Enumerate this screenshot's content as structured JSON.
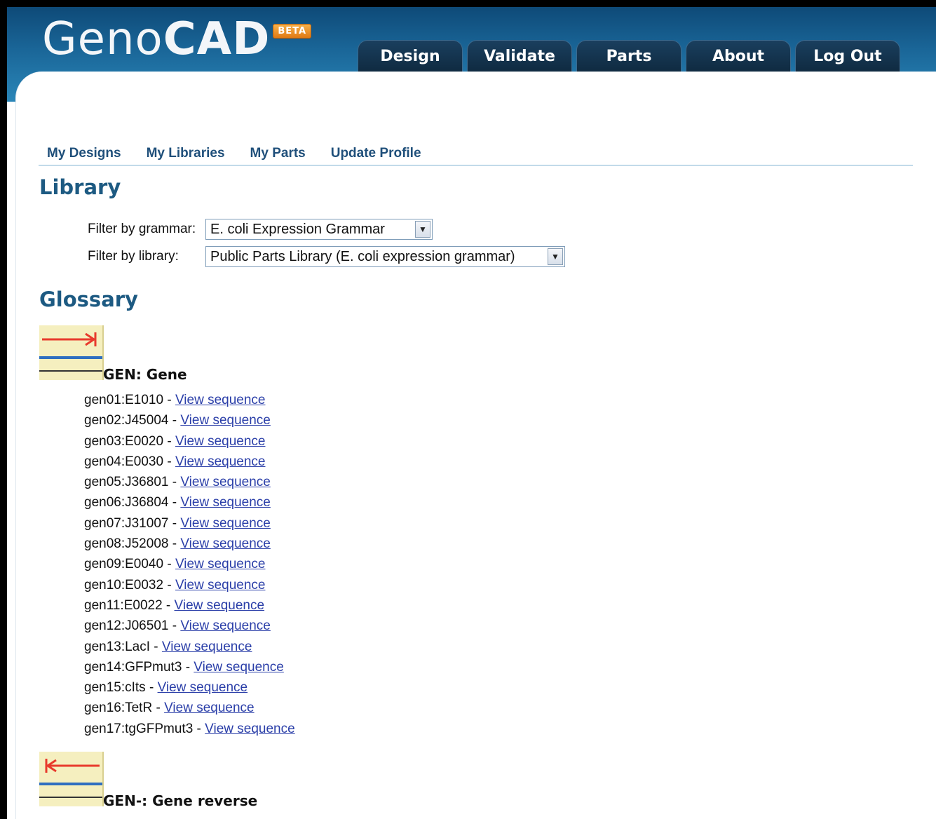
{
  "header": {
    "logo_text_light": "Geno",
    "logo_text_bold": "CAD",
    "logo_badge": "BETA",
    "tabs": [
      "Design",
      "Validate",
      "Parts",
      "About",
      "Log Out"
    ]
  },
  "subnav": {
    "links": [
      "My Designs",
      "My Libraries",
      "My Parts",
      "Update Profile"
    ]
  },
  "library": {
    "title": "Library",
    "grammar_label": "Filter by grammar:",
    "grammar_value": "E. coli Expression Grammar",
    "library_label": "Filter by library:",
    "library_value": "Public Parts Library (E. coli expression grammar)"
  },
  "glossary": {
    "title": "Glossary",
    "categories": [
      {
        "code_title": "GEN: Gene",
        "icon": "gene-forward-icon",
        "parts": [
          {
            "id": "gen01:E1010 - ",
            "link": "View sequence"
          },
          {
            "id": "gen02:J45004 - ",
            "link": "View sequence"
          },
          {
            "id": "gen03:E0020 - ",
            "link": "View sequence"
          },
          {
            "id": "gen04:E0030 - ",
            "link": "View sequence"
          },
          {
            "id": "gen05:J36801 - ",
            "link": "View sequence"
          },
          {
            "id": "gen06:J36804 - ",
            "link": "View sequence"
          },
          {
            "id": "gen07:J31007 - ",
            "link": "View sequence"
          },
          {
            "id": "gen08:J52008 - ",
            "link": "View sequence"
          },
          {
            "id": "gen09:E0040 - ",
            "link": "View sequence"
          },
          {
            "id": "gen10:E0032 - ",
            "link": "View sequence"
          },
          {
            "id": "gen11:E0022 - ",
            "link": "View sequence"
          },
          {
            "id": "gen12:J06501 - ",
            "link": "View sequence"
          },
          {
            "id": "gen13:LacI - ",
            "link": "View sequence"
          },
          {
            "id": "gen14:GFPmut3 - ",
            "link": "View sequence"
          },
          {
            "id": "gen15:cIts - ",
            "link": "View sequence"
          },
          {
            "id": "gen16:TetR - ",
            "link": "View sequence"
          },
          {
            "id": "gen17:tgGFPmut3 - ",
            "link": "View sequence"
          }
        ]
      },
      {
        "code_title": "GEN-: Gene reverse",
        "icon": "gene-reverse-icon"
      }
    ]
  },
  "colors": {
    "header_blue": "#1a6698",
    "tab_dark": "#0f2a40",
    "heading_blue": "#1d5a82",
    "link_blue": "#2a3ea8",
    "icon_red": "#e83a2c",
    "icon_blue": "#2f6fc0"
  }
}
